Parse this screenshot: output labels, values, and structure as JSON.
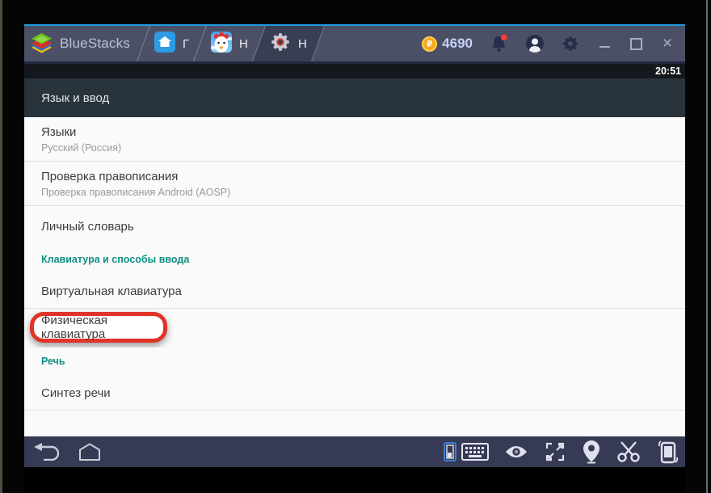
{
  "titlebar": {
    "brand": "BlueStacks",
    "tabs": [
      {
        "label": "Г",
        "icon": "home-icon"
      },
      {
        "label": "Н",
        "icon": "chicken-app-icon"
      },
      {
        "label": "Н",
        "icon": "settings-gear-icon",
        "active": true
      }
    ],
    "points": "4690",
    "coin_glyph": "₽",
    "window_controls": {
      "close": "×"
    }
  },
  "statusbar": {
    "time": "20:51"
  },
  "app": {
    "header_title": "Язык и ввод",
    "rows": [
      {
        "title": "Языки",
        "subtitle": "Русский (Россия)"
      },
      {
        "title": "Проверка правописания",
        "subtitle": "Проверка правописания Android (AOSP)"
      },
      {
        "title": "Личный словарь"
      },
      {
        "section": "Клавиатура и способы ввода"
      },
      {
        "title": "Виртуальная клавиатура"
      },
      {
        "title": "Физическая клавиатура",
        "highlighted": true
      },
      {
        "section": "Речь"
      },
      {
        "title": "Синтез речи"
      }
    ]
  },
  "navbar": {
    "icons": [
      "back-icon",
      "home-nav-icon",
      "keyboard-toggle-icon",
      "keyboard-icon",
      "eye-icon",
      "fullscreen-icon",
      "location-icon",
      "scissors-icon",
      "rotate-device-icon"
    ]
  },
  "colors": {
    "accent_teal": "#0e8f82",
    "highlight_red": "#e23329",
    "titlebar": "#4c5067",
    "titlebar_blue_line": "#1e9be0",
    "navbar": "#363a55",
    "coin_gold": "#f9a51a",
    "list_bg": "#fafafa",
    "header_bg": "#28333b"
  }
}
